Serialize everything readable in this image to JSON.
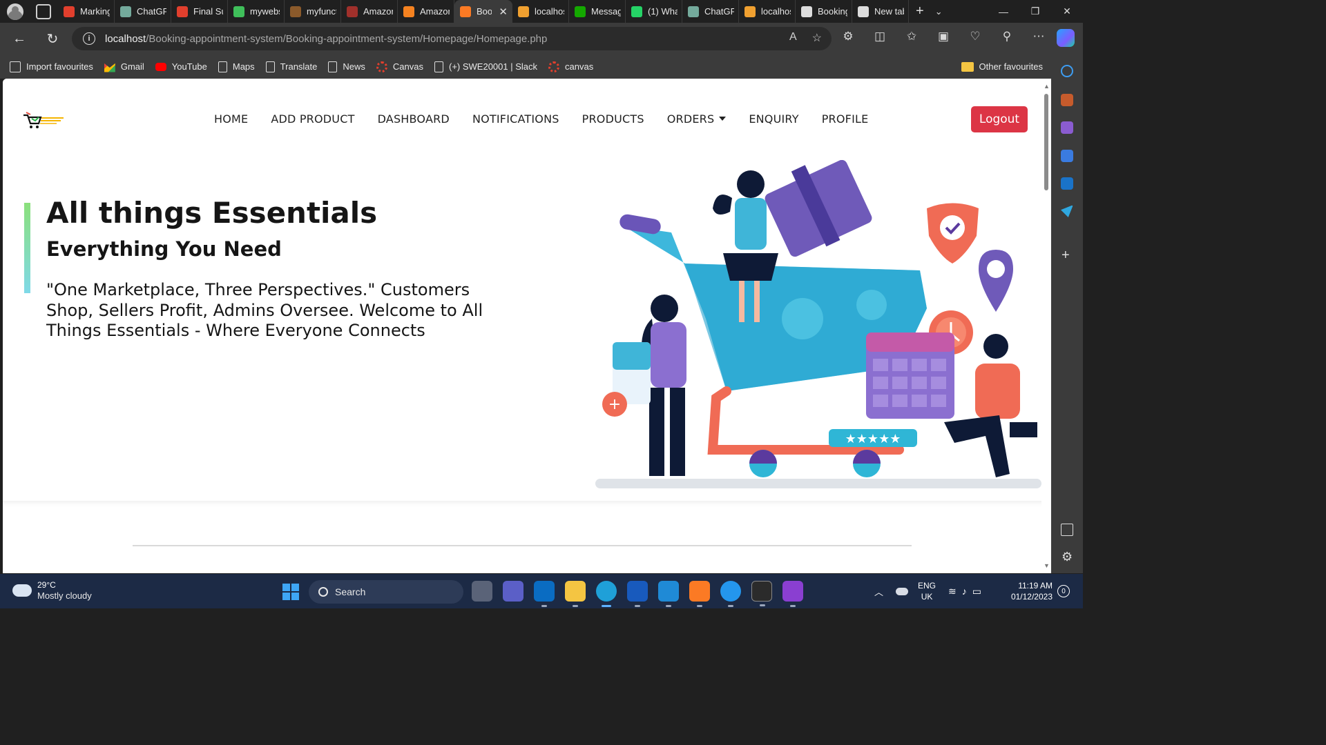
{
  "browser": {
    "tabs": [
      {
        "title": "Marking",
        "favicon": "canvas-icon",
        "color": "#e13f2d"
      },
      {
        "title": "ChatGPT",
        "favicon": "chatgpt-icon",
        "color": "#74aa9c"
      },
      {
        "title": "Final Su",
        "favicon": "canvas-icon",
        "color": "#e13f2d"
      },
      {
        "title": "mywebs",
        "favicon": "code-icon",
        "color": "#3fbf5a"
      },
      {
        "title": "myfunct",
        "favicon": "aws-icon",
        "color": "#8b5a2b"
      },
      {
        "title": "Amazon",
        "favicon": "aws-icon",
        "color": "#a0302b"
      },
      {
        "title": "Amazon",
        "favicon": "aws-icon",
        "color": "#f58220"
      },
      {
        "title": "Boo",
        "favicon": "xampp-icon",
        "color": "#fb7a24",
        "active": true
      },
      {
        "title": "localhos",
        "favicon": "phpmyadmin-icon",
        "color": "#f0a030"
      },
      {
        "title": "Messag",
        "favicon": "upwork-icon",
        "color": "#14a800"
      },
      {
        "title": "(1) Wha",
        "favicon": "whatsapp-icon",
        "color": "#25d366"
      },
      {
        "title": "ChatGPT",
        "favicon": "chatgpt-icon",
        "color": "#74aa9c"
      },
      {
        "title": "localhos",
        "favicon": "phpmyadmin-icon",
        "color": "#f0a030"
      },
      {
        "title": "Booking",
        "favicon": "page-icon",
        "color": "#dddddd"
      },
      {
        "title": "New tab",
        "favicon": "newtab-icon",
        "color": "#dddddd"
      }
    ],
    "url_host": "localhost",
    "url_path": "/Booking-appointment-system/Booking-appointment-system/Homepage/Homepage.php",
    "favourites": [
      {
        "label": "Import favourites",
        "icon": "import"
      },
      {
        "label": "Gmail",
        "icon": "gmail"
      },
      {
        "label": "YouTube",
        "icon": "yt"
      },
      {
        "label": "Maps",
        "icon": "page"
      },
      {
        "label": "Translate",
        "icon": "page"
      },
      {
        "label": "News",
        "icon": "page"
      },
      {
        "label": "Canvas",
        "icon": "canvas"
      },
      {
        "label": "(+) SWE20001 | Slack",
        "icon": "page"
      },
      {
        "label": "canvas",
        "icon": "canvas"
      }
    ],
    "other_favourites": "Other favourites"
  },
  "site": {
    "nav": [
      "HOME",
      "ADD PRODUCT",
      "DASHBOARD",
      "NOTIFICATIONS",
      "PRODUCTS",
      "ORDERS",
      "ENQUIRY",
      "PROFILE"
    ],
    "logout": "Logout",
    "hero_title": "All things Essentials",
    "hero_subtitle": "Everything You Need",
    "hero_body": "\"One Marketplace, Three Perspectives.\" Customers Shop, Sellers Profit, Admins Oversee. Welcome to All Things Essentials - Where Everyone Connects",
    "accent_color": "#dc3545"
  },
  "taskbar": {
    "temp": "29°C",
    "weather": "Mostly cloudy",
    "search": "Search",
    "lang1": "ENG",
    "lang2": "UK",
    "time": "11:19 AM",
    "date": "01/12/2023",
    "notifications": "0"
  }
}
